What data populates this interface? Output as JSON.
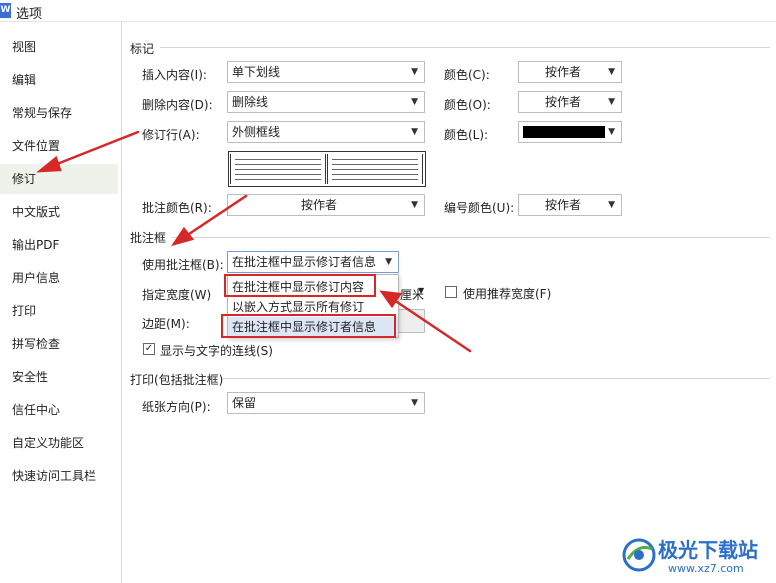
{
  "window": {
    "title": "选项",
    "app_icon": "W"
  },
  "sidebar": {
    "items": [
      {
        "label": "视图"
      },
      {
        "label": "编辑"
      },
      {
        "label": "常规与保存"
      },
      {
        "label": "文件位置"
      },
      {
        "label": "修订",
        "active": true
      },
      {
        "label": "中文版式"
      },
      {
        "label": "输出PDF"
      },
      {
        "label": "用户信息"
      },
      {
        "label": "打印"
      },
      {
        "label": "拼写检查"
      },
      {
        "label": "安全性"
      },
      {
        "label": "信任中心"
      },
      {
        "label": "自定义功能区"
      },
      {
        "label": "快速访问工具栏"
      }
    ]
  },
  "markup": {
    "title": "标记",
    "insert_label": "插入内容(I):",
    "insert_value": "单下划线",
    "insert_color_label": "颜色(C):",
    "insert_color_value": "按作者",
    "delete_label": "删除内容(D):",
    "delete_value": "删除线",
    "delete_color_label": "颜色(O):",
    "delete_color_value": "按作者",
    "revline_label": "修订行(A):",
    "revline_value": "外侧框线",
    "revline_color_label": "颜色(L):",
    "revline_color_value": "#000000",
    "comment_color_label": "批注颜色(R):",
    "comment_color_value": "按作者",
    "number_color_label": "编号颜色(U):",
    "number_color_value": "按作者"
  },
  "balloons": {
    "title": "批注框",
    "use_label": "使用批注框(B):",
    "use_value": "在批注框中显示修订者信息",
    "options": [
      "在批注框中显示修订内容",
      "以嵌入方式显示所有修订",
      "在批注框中显示修订者信息"
    ],
    "width_label": "指定宽度(W)",
    "width_unit": "厘米",
    "recommend_width_label": "使用推荐宽度(F)",
    "recommend_width_checked": false,
    "margin_label": "边距(M):",
    "show_lines_label": "显示与文字的连线(S)",
    "show_lines_checked": true
  },
  "printing": {
    "title": "打印(包括批注框)",
    "orientation_label": "纸张方向(P):",
    "orientation_value": "保留"
  },
  "checkmark": "✓",
  "dropdown_arrow": "▼",
  "watermark": {
    "name": "极光下载站",
    "url": "www.xz7.com"
  },
  "colors": {
    "annotation": "#d62828",
    "active_bg": "#edf3ea",
    "selected_bg": "#dde6f4"
  }
}
